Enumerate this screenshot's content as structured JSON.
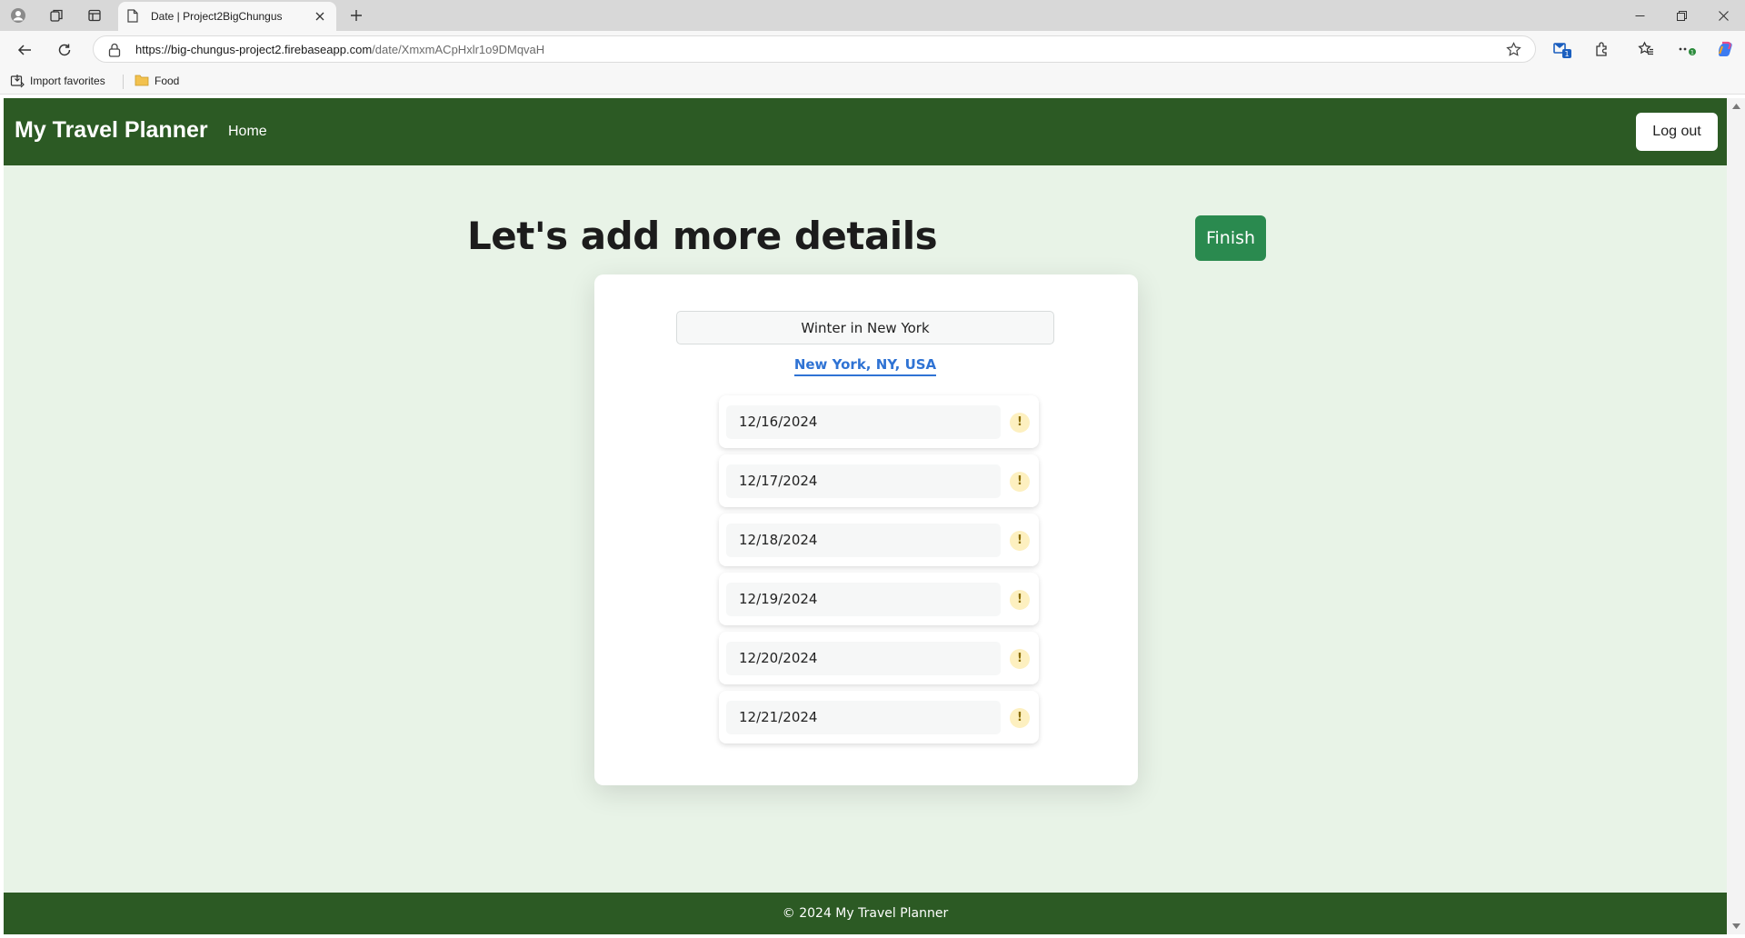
{
  "browser": {
    "tab_title": "Date | Project2BigChungus",
    "url_domain": "https://big-chungus-project2.firebaseapp.com",
    "url_path": "/date/XmxmACpHxlr1o9DMqvaH",
    "bookmarks": [
      {
        "label": "Import favorites",
        "icon": "import-icon"
      },
      {
        "label": "Food",
        "icon": "folder-icon"
      }
    ],
    "extension_badges": {
      "mail": "1",
      "copilot_dot": "1"
    }
  },
  "navbar": {
    "brand": "My Travel Planner",
    "home_link": "Home",
    "logout_label": "Log out"
  },
  "main": {
    "heading": "Let's add more details",
    "finish_label": "Finish",
    "trip_name": "Winter in New York",
    "location": "New York, NY, USA",
    "dates": [
      {
        "date": "12/16/2024",
        "status": "!"
      },
      {
        "date": "12/17/2024",
        "status": "!"
      },
      {
        "date": "12/18/2024",
        "status": "!"
      },
      {
        "date": "12/19/2024",
        "status": "!"
      },
      {
        "date": "12/20/2024",
        "status": "!"
      },
      {
        "date": "12/21/2024",
        "status": "!"
      }
    ]
  },
  "footer": {
    "text": "© 2024 My Travel Planner"
  },
  "colors": {
    "nav_green": "#2c5a24",
    "page_bg": "#e8f3e7",
    "finish_green": "#2a8a4f",
    "link_blue": "#2f73d4",
    "warn_bg": "#fdf0c0"
  }
}
